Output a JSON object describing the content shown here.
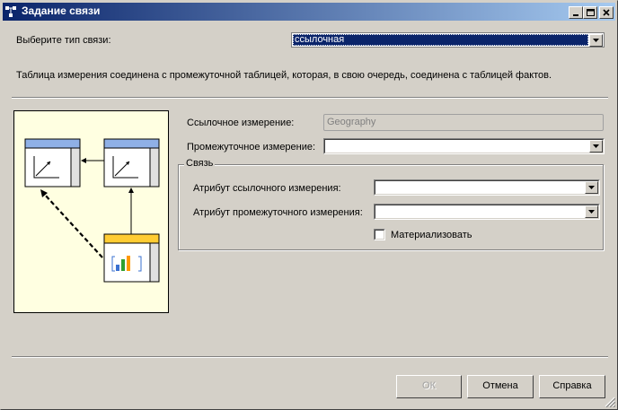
{
  "window": {
    "title": "Задание связи"
  },
  "relation_type": {
    "label": "Выберите тип связи:",
    "value": "ссылочная"
  },
  "description": "Таблица измерения соединена с промежуточной таблицей, которая, в свою очередь, соединена с таблицей фактов.",
  "reference_dimension": {
    "label": "Ссылочное измерение:",
    "value": "Geography"
  },
  "intermediate_dimension": {
    "label": "Промежуточное измерение:",
    "value": ""
  },
  "relationship": {
    "title": "Связь",
    "reference_attribute": {
      "label": "Атрибут ссылочного измерения:",
      "value": ""
    },
    "intermediate_attribute": {
      "label": "Атрибут промежуточного измерения:",
      "value": ""
    },
    "materialize": {
      "label": "Материализовать",
      "checked": false
    }
  },
  "buttons": {
    "ok": "ОК",
    "cancel": "Отмена",
    "help": "Справка"
  },
  "colors": {
    "title_start": "#0a246a",
    "title_end": "#a6caf0",
    "diagram_bg": "#ffffe1",
    "selection": "#0a246a"
  }
}
